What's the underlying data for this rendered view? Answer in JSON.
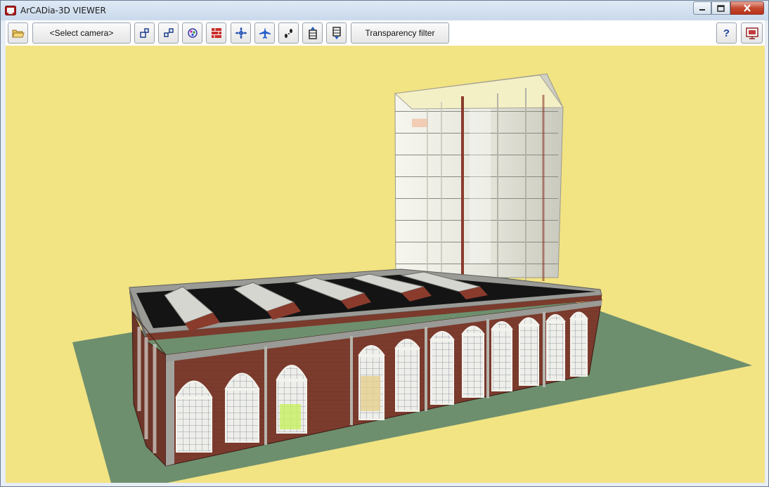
{
  "window": {
    "title": "ArCADia-3D VIEWER"
  },
  "toolbar": {
    "open_icon": "folder-open-icon",
    "select_camera_label": "<Select camera>",
    "transparency_filter_label": "Transparency filter",
    "help_label": "?"
  },
  "colors": {
    "viewport_background": "#f2e383",
    "ground": "#6b8f6c",
    "brick": "#7a3a2c",
    "tower_glass": "#e9eadf"
  }
}
